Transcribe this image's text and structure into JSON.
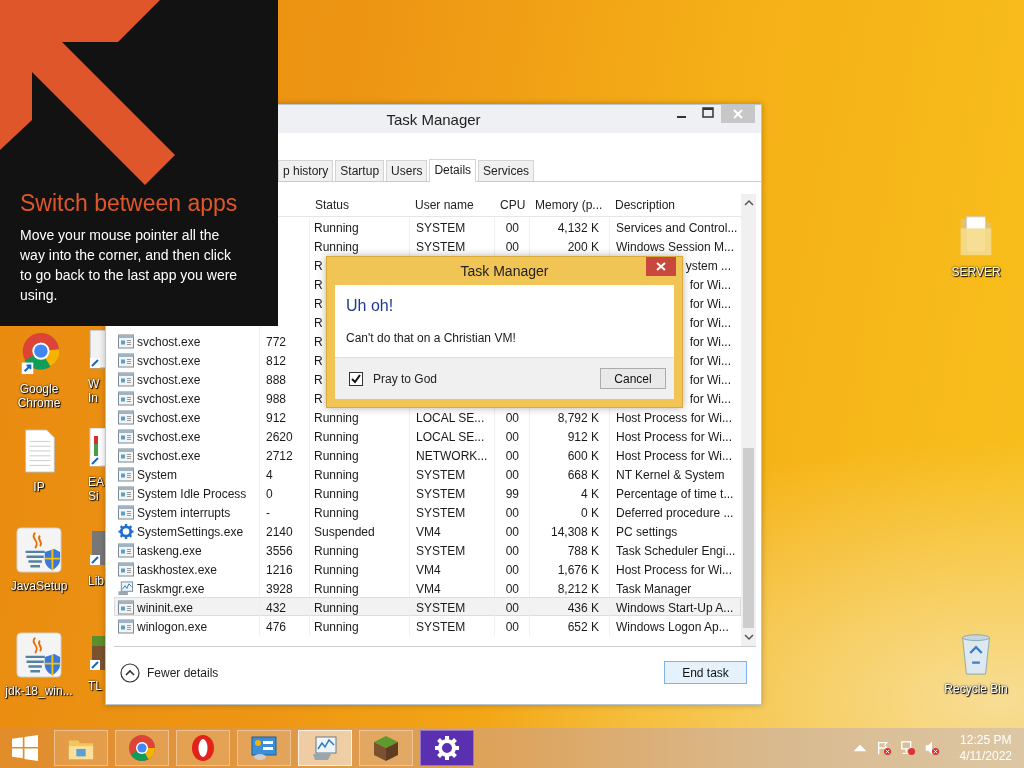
{
  "charm_hint": {
    "heading": "Switch between apps",
    "text": "Move your mouse pointer all the way into the corner, and then click to go back to the last app you were using."
  },
  "desktop_icons": [
    {
      "kind": "chrome",
      "label": "Google Chrome"
    },
    {
      "kind": "textfile",
      "label": "IP"
    },
    {
      "kind": "java",
      "label": "JavaSetup"
    },
    {
      "kind": "java",
      "label": "jdk-18_win..."
    }
  ],
  "desktop_icons_partial": [
    {
      "kind": "document",
      "label": "W In"
    },
    {
      "kind": "chart",
      "label": "EA Si"
    },
    {
      "kind": "box",
      "label": "Lib"
    },
    {
      "kind": "block",
      "label": "TL"
    }
  ],
  "desktop_icons_right": [
    {
      "kind": "folder",
      "label": "SERVER"
    },
    {
      "kind": "recycle",
      "label": "Recycle Bin"
    }
  ],
  "task_manager": {
    "title": "Task Manager",
    "tabs": [
      {
        "label": "p history",
        "selected": false
      },
      {
        "label": "Startup",
        "selected": false
      },
      {
        "label": "Users",
        "selected": false
      },
      {
        "label": "Details",
        "selected": true
      },
      {
        "label": "Services",
        "selected": false
      }
    ],
    "columns": [
      "Status",
      "User name",
      "CPU",
      "Memory (p...",
      "Description"
    ],
    "rows": [
      {
        "status": "Running",
        "user": "SYSTEM",
        "cpu": "00",
        "memory": "4,132 K",
        "description": "Services and Control...",
        "behind_dialog": false,
        "selected": false
      },
      {
        "status": "Running",
        "user": "SYSTEM",
        "cpu": "00",
        "memory": "200 K",
        "description": "Windows Session M...",
        "behind_dialog": false,
        "selected": false
      },
      {
        "status": "R",
        "description": "ystem ...",
        "behind_dialog": true,
        "selected": false
      },
      {
        "status": "R",
        "description": "for Wi...",
        "behind_dialog": true,
        "selected": false
      },
      {
        "status": "R",
        "description": "for Wi...",
        "behind_dialog": true,
        "selected": false
      },
      {
        "status": "R",
        "description": "for Wi...",
        "behind_dialog": true,
        "selected": false
      },
      {
        "kind": "app",
        "name": "svchost.exe",
        "pid": "772",
        "status": "R",
        "description": "for Wi...",
        "behind_dialog": true,
        "selected": false
      },
      {
        "kind": "app",
        "name": "svchost.exe",
        "pid": "812",
        "status": "R",
        "description": "for Wi...",
        "behind_dialog": true,
        "selected": false
      },
      {
        "kind": "app",
        "name": "svchost.exe",
        "pid": "888",
        "status": "R",
        "description": "for Wi...",
        "behind_dialog": true,
        "selected": false
      },
      {
        "kind": "app",
        "name": "svchost.exe",
        "pid": "988",
        "status": "R",
        "description": "for Wi...",
        "behind_dialog": true,
        "selected": false
      },
      {
        "kind": "app",
        "name": "svchost.exe",
        "pid": "912",
        "status": "Running",
        "user": "LOCAL SE...",
        "cpu": "00",
        "memory": "8,792 K",
        "description": "Host Process for Wi...",
        "behind_dialog": false,
        "selected": false
      },
      {
        "kind": "app",
        "name": "svchost.exe",
        "pid": "2620",
        "status": "Running",
        "user": "LOCAL SE...",
        "cpu": "00",
        "memory": "912 K",
        "description": "Host Process for Wi...",
        "behind_dialog": false,
        "selected": false
      },
      {
        "kind": "app",
        "name": "svchost.exe",
        "pid": "2712",
        "status": "Running",
        "user": "NETWORK...",
        "cpu": "00",
        "memory": "600 K",
        "description": "Host Process for Wi...",
        "behind_dialog": false,
        "selected": false
      },
      {
        "kind": "app",
        "name": "System",
        "pid": "4",
        "status": "Running",
        "user": "SYSTEM",
        "cpu": "00",
        "memory": "668 K",
        "description": "NT Kernel & System",
        "behind_dialog": false,
        "selected": false
      },
      {
        "kind": "app",
        "name": "System Idle Process",
        "pid": "0",
        "status": "Running",
        "user": "SYSTEM",
        "cpu": "99",
        "memory": "4 K",
        "description": "Percentage of time t...",
        "behind_dialog": false,
        "selected": false
      },
      {
        "kind": "app",
        "name": "System interrupts",
        "pid": "-",
        "status": "Running",
        "user": "SYSTEM",
        "cpu": "00",
        "memory": "0 K",
        "description": "Deferred procedure ...",
        "behind_dialog": false,
        "selected": false
      },
      {
        "kind": "settings",
        "name": "SystemSettings.exe",
        "pid": "2140",
        "status": "Suspended",
        "user": "VM4",
        "cpu": "00",
        "memory": "14,308 K",
        "description": "PC settings",
        "behind_dialog": false,
        "selected": false
      },
      {
        "kind": "app",
        "name": "taskeng.exe",
        "pid": "3556",
        "status": "Running",
        "user": "SYSTEM",
        "cpu": "00",
        "memory": "788 K",
        "description": "Task Scheduler Engi...",
        "behind_dialog": false,
        "selected": false
      },
      {
        "kind": "app",
        "name": "taskhostex.exe",
        "pid": "1216",
        "status": "Running",
        "user": "VM4",
        "cpu": "00",
        "memory": "1,676 K",
        "description": "Host Process for Wi...",
        "behind_dialog": false,
        "selected": false
      },
      {
        "kind": "monitor",
        "name": "Taskmgr.exe",
        "pid": "3928",
        "status": "Running",
        "user": "VM4",
        "cpu": "00",
        "memory": "8,212 K",
        "description": "Task Manager",
        "behind_dialog": false,
        "selected": false
      },
      {
        "kind": "app",
        "name": "wininit.exe",
        "pid": "432",
        "status": "Running",
        "user": "SYSTEM",
        "cpu": "00",
        "memory": "436 K",
        "description": "Windows Start-Up A...",
        "behind_dialog": false,
        "selected": true
      },
      {
        "kind": "app",
        "name": "winlogon.exe",
        "pid": "476",
        "status": "Running",
        "user": "SYSTEM",
        "cpu": "00",
        "memory": "652 K",
        "description": "Windows Logon Ap...",
        "behind_dialog": false,
        "selected": false
      }
    ],
    "fewer_details": "Fewer details",
    "end_task": "End task"
  },
  "dialog": {
    "title": "Task Manager",
    "heading": "Uh oh!",
    "message": "Can't do that on a Christian VM!",
    "checkbox": {
      "label": "Pray to God",
      "checked": true
    },
    "button": "Cancel"
  },
  "taskbar": {
    "apps": [
      {
        "kind": "explorer",
        "active": false
      },
      {
        "kind": "chrome",
        "active": false
      },
      {
        "kind": "opera",
        "active": false
      },
      {
        "kind": "panel",
        "active": false
      },
      {
        "kind": "monitor",
        "active": true
      },
      {
        "kind": "block",
        "active": false
      },
      {
        "kind": "gear",
        "active": false
      }
    ],
    "time": "12:25 PM",
    "date": "4/11/2022"
  }
}
